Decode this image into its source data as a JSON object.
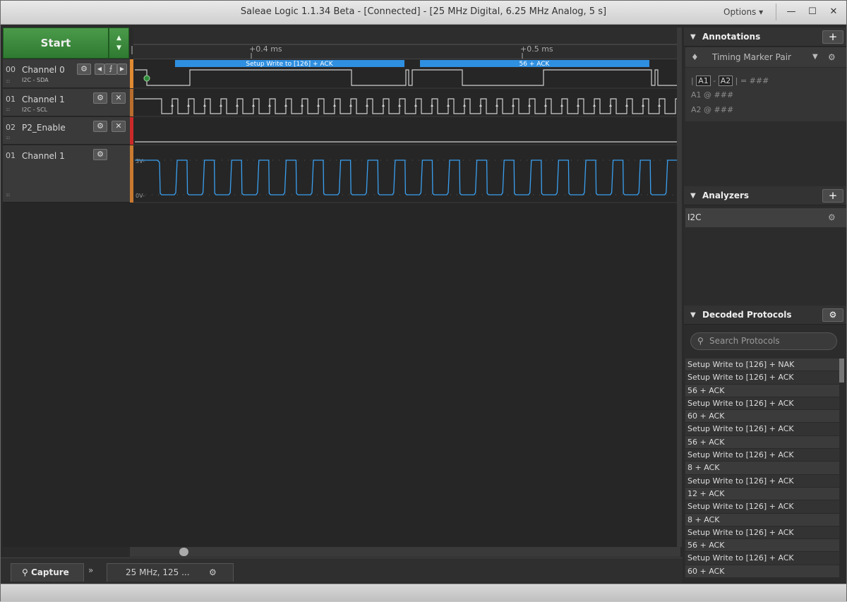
{
  "window": {
    "title": "Saleae Logic 1.1.34 Beta - [Connected] - [25 MHz Digital, 6.25 MHz Analog, 5 s]",
    "options_label": "Options ▾",
    "btn_minimize": "—",
    "btn_maximize": "☐",
    "btn_close": "✕"
  },
  "capture": {
    "start_label": "Start",
    "arrows": "▲\n▼"
  },
  "timeline": {
    "ticks": [
      "+0.4 ms",
      "+0.5 ms"
    ],
    "segments": [
      "Setup Write to [126] + ACK",
      "56 + ACK"
    ]
  },
  "channels": [
    {
      "num": "00",
      "name": "Channel 0",
      "sub": "I2C - SDA",
      "color": "#e08a32"
    },
    {
      "num": "01",
      "name": "Channel 1",
      "sub": "I2C - SCL",
      "color": "#b86d2e"
    },
    {
      "num": "02",
      "name": "P2_Enable",
      "sub": "",
      "color": "#cc2a2a"
    },
    {
      "num": "01",
      "name": "Channel 1",
      "sub": "",
      "color": "#c97a30"
    }
  ],
  "analog": {
    "high_label": "3V-",
    "low_label": "0V-"
  },
  "bottom": {
    "capture_tab": "Capture",
    "expand": "»",
    "sample_rate": "25 MHz, 125 ..."
  },
  "annotations": {
    "header": "Annotations",
    "marker_type": "Timing Marker Pair",
    "pair_a1": "A1",
    "pair_a2": "A2",
    "pair_value": "= ###",
    "a1_label": "A1",
    "a1_value": "@  ###",
    "a2_label": "A2",
    "a2_value": "@  ###"
  },
  "analyzers": {
    "header": "Analyzers",
    "items": [
      "I2C"
    ]
  },
  "decoded": {
    "header": "Decoded Protocols",
    "search_placeholder": "Search Protocols",
    "items": [
      "Setup Write to [126] + NAK",
      "Setup Write to [126] + ACK",
      "56 + ACK",
      "Setup Write to [126] + ACK",
      "60 + ACK",
      "Setup Write to [126] + ACK",
      "56 + ACK",
      "Setup Write to [126] + ACK",
      "8 + ACK",
      "Setup Write to [126] + ACK",
      "12 + ACK",
      "Setup Write to [126] + ACK",
      "8 + ACK",
      "Setup Write to [126] + ACK",
      "56 + ACK",
      "Setup Write to [126] + ACK",
      "60 + ACK"
    ]
  },
  "colors": {
    "accent_blue": "#2f8fe0",
    "start_green": "#3a8a3c",
    "wave_blue": "#3aa0f0"
  }
}
